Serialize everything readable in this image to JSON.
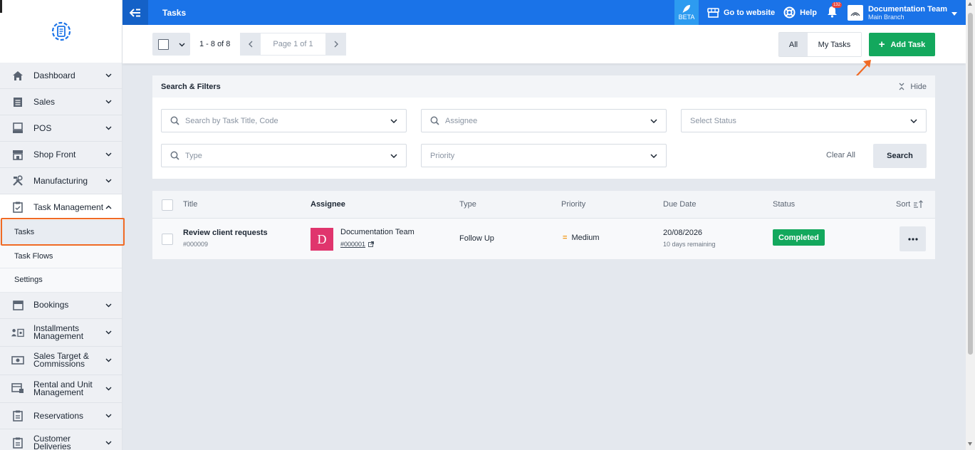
{
  "topbar": {
    "page_title": "Tasks",
    "beta_label": "BETA",
    "go_to_website": "Go to website",
    "help": "Help",
    "notification_count": "132",
    "user_name": "Documentation Team",
    "branch": "Main Branch"
  },
  "sidebar": {
    "items": [
      {
        "label": "Dashboard",
        "icon": "home-icon"
      },
      {
        "label": "Sales",
        "icon": "receipt-icon"
      },
      {
        "label": "POS",
        "icon": "pos-terminal-icon"
      },
      {
        "label": "Shop Front",
        "icon": "storefront-icon"
      },
      {
        "label": "Manufacturing",
        "icon": "tools-icon"
      },
      {
        "label": "Task Management",
        "icon": "clipboard-check-icon"
      },
      {
        "label": "Bookings",
        "icon": "calendar-icon"
      },
      {
        "label": "Installments Management",
        "icon": "users-money-icon"
      },
      {
        "label": "Sales Target & Commissions",
        "icon": "banknote-icon"
      },
      {
        "label": "Rental and Unit Management",
        "icon": "rental-unit-icon"
      },
      {
        "label": "Reservations",
        "icon": "clipboard-icon"
      },
      {
        "label": "Customer Deliveries",
        "icon": "clipboard-icon"
      }
    ],
    "sub_items": [
      "Tasks",
      "Task Flows",
      "Settings"
    ]
  },
  "toolbar": {
    "count_text": "1 - 8 of 8",
    "page_text": "Page 1 of 1",
    "filter_all": "All",
    "filter_my_tasks": "My Tasks",
    "add_task": "Add Task"
  },
  "filters": {
    "heading": "Search & Filters",
    "hide": "Hide",
    "search_placeholder": "Search by Task Title, Code",
    "assignee_placeholder": "Assignee",
    "status_placeholder": "Select Status",
    "type_placeholder": "Type",
    "priority_placeholder": "Priority",
    "clear_all": "Clear All",
    "search_button": "Search"
  },
  "table": {
    "columns": {
      "title": "Title",
      "assignee": "Assignee",
      "type": "Type",
      "priority": "Priority",
      "due_date": "Due Date",
      "status": "Status",
      "sort": "Sort"
    },
    "rows": [
      {
        "title": "Review client requests",
        "code": "#000009",
        "avatar_letter": "D",
        "assignee": "Documentation Team",
        "assignee_code": "#000001",
        "type": "Follow Up",
        "priority": "Medium",
        "due_date": "20/08/2026",
        "remaining": "10 days remaining",
        "status": "Completed"
      }
    ]
  },
  "colors": {
    "primary": "#1a73e8",
    "success": "#13a85d",
    "avatar": "#e0356d",
    "highlight": "#f06a24",
    "priority_medium": "#f29a1a"
  }
}
